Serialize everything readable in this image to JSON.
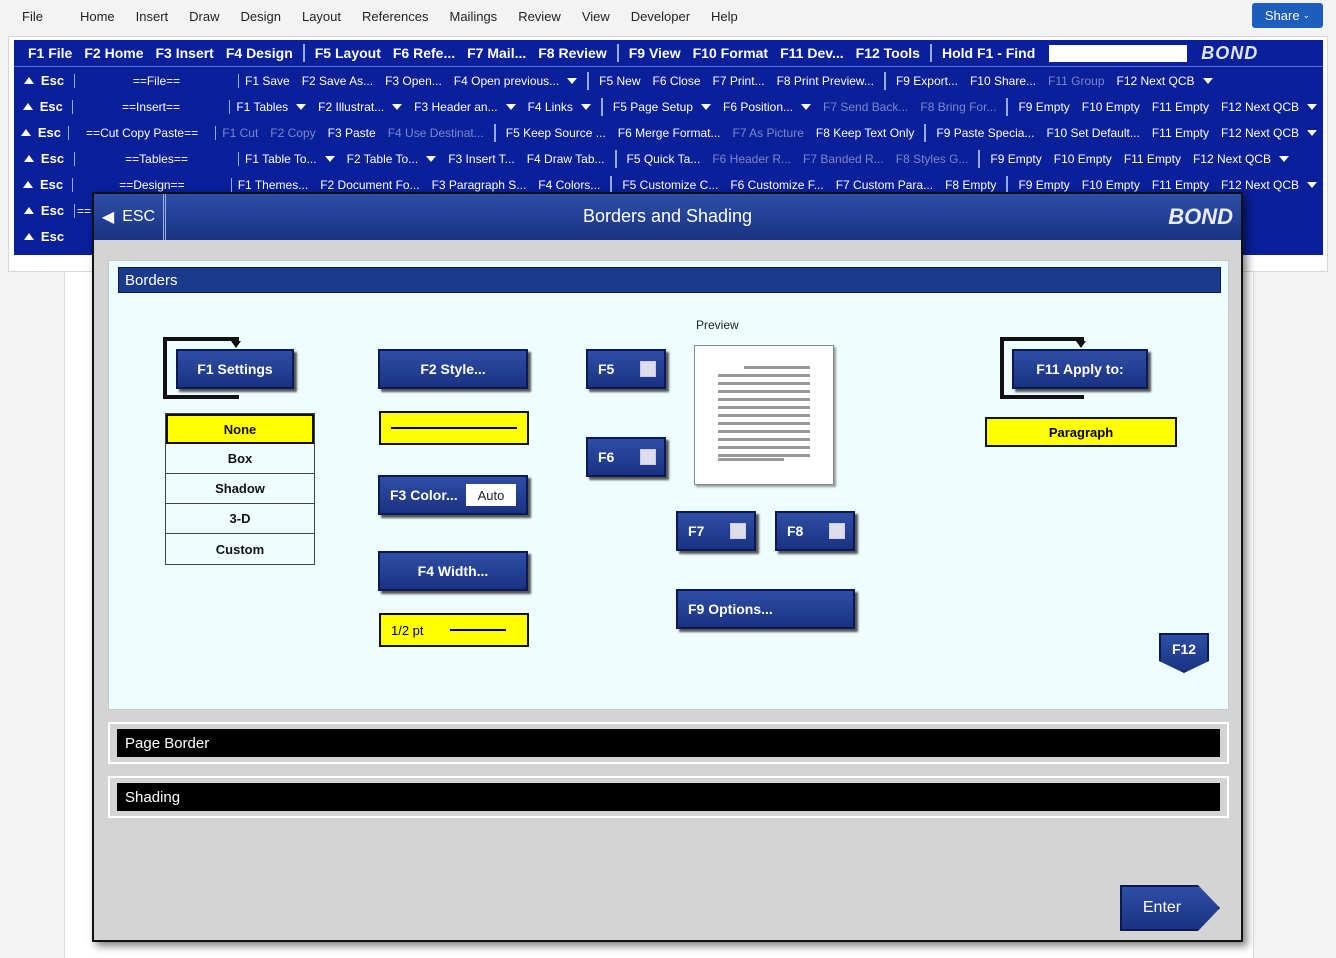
{
  "menu": [
    "File",
    "Home",
    "Insert",
    "Draw",
    "Design",
    "Layout",
    "References",
    "Mailings",
    "Review",
    "View",
    "Developer",
    "Help"
  ],
  "share_label": "Share",
  "toolbar": {
    "main": [
      "F1 File",
      "F2 Home",
      "F3 Insert",
      "F4 Design",
      "F5 Layout",
      "F6 Refe...",
      "F7 Mail...",
      "F8 Review",
      "F9 View",
      "F10 Format",
      "F11 Dev...",
      "F12 Tools",
      "Hold F1 - Find"
    ],
    "logo": "BOND",
    "rows": [
      {
        "esc": "Esc",
        "group": "==File==",
        "items": [
          "F1 Save",
          "F2 Save As...",
          "F3 Open...",
          "F4 Open previous...",
          "F5 New",
          "F6 Close",
          "F7 Print...",
          "F8 Print Preview...",
          "F9 Export...",
          "F10 Share...",
          "F11 Group",
          "F12 Next QCB"
        ]
      },
      {
        "esc": "Esc",
        "group": "==Insert==",
        "items": [
          "F1 Tables",
          "F2 Illustrat...",
          "F3 Header an...",
          "F4 Links",
          "F5 Page Setup",
          "F6 Position...",
          "F7 Send Back...",
          "F8 Bring For...",
          "F9 Empty",
          "F10 Empty",
          "F11 Empty",
          "F12 Next QCB"
        ]
      },
      {
        "esc": "Esc",
        "group": "==Cut Copy Paste==",
        "items": [
          "F1 Cut",
          "F2 Copy",
          "F3 Paste",
          "F4 Use Destinat...",
          "F5 Keep Source ...",
          "F6 Merge Format...",
          "F7 As Picture",
          "F8 Keep Text Only",
          "F9 Paste Specia...",
          "F10 Set Default...",
          "F11 Empty",
          "F12 Next QCB"
        ]
      },
      {
        "esc": "Esc",
        "group": "==Tables==",
        "items": [
          "F1 Table To...",
          "F2 Table To...",
          "F3 Insert T...",
          "F4 Draw Tab...",
          "F5 Quick Ta...",
          "F6 Header R...",
          "F7 Banded R...",
          "F8 Styles G...",
          "F9 Empty",
          "F10 Empty",
          "F11 Empty",
          "F12 Next QCB"
        ]
      },
      {
        "esc": "Esc",
        "group": "==Design==",
        "items": [
          "F1 Themes...",
          "F2 Document Fo...",
          "F3 Paragraph S...",
          "F4 Colors...",
          "F5 Customize C...",
          "F6 Customize F...",
          "F7 Custom Para...",
          "F8 Empty",
          "F9 Empty",
          "F10 Empty",
          "F11 Empty",
          "F12 Next QCB"
        ]
      },
      {
        "esc": "Esc",
        "group": "==",
        "items": []
      },
      {
        "esc": "Esc",
        "group": "",
        "items": []
      }
    ]
  },
  "dialog": {
    "esc_label": "ESC",
    "title": "Borders and Shading",
    "logo": "BOND",
    "borders_label": "Borders",
    "settings_btn": "F1 Settings",
    "settings": [
      "None",
      "Box",
      "Shadow",
      "3-D",
      "Custom"
    ],
    "style_btn": "F2 Style...",
    "color_btn": "F3 Color...",
    "color_value": "Auto",
    "width_btn": "F4 Width...",
    "width_value": "1/2 pt",
    "f5": "F5",
    "f6": "F6",
    "f7": "F7",
    "f8": "F8",
    "options_btn": "F9 Options...",
    "preview_label": "Preview",
    "apply_btn": "F11 Apply to:",
    "apply_value": "Paragraph",
    "f12": "F12",
    "page_border_label": "Page Border",
    "shading_label": "Shading",
    "enter_label": "Enter"
  }
}
